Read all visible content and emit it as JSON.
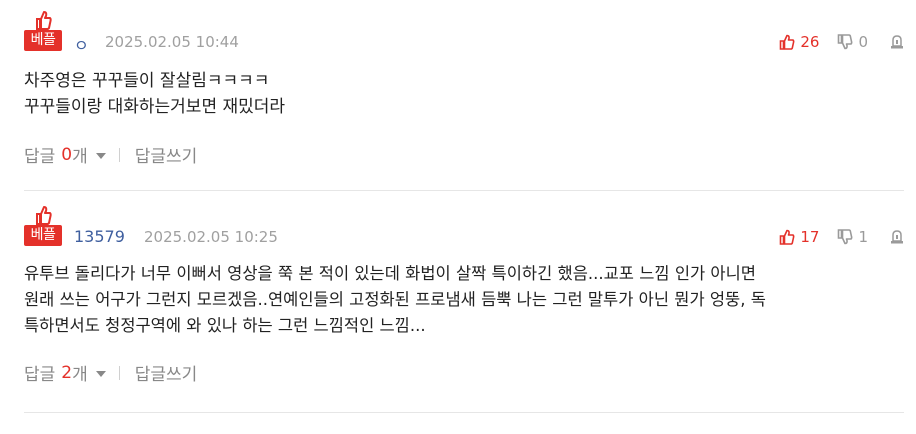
{
  "badge_label": "베플",
  "colors": {
    "accent": "#e4312a",
    "nick": "#3f5f9f",
    "muted": "#a0a0a0"
  },
  "comments": [
    {
      "nickname": "ㅇ",
      "date": "2025.02.05 10:44",
      "likes": "26",
      "dislikes": "0",
      "lines": [
        "차주영은 꾸꾸들이 잘살림ㅋㅋㅋㅋ",
        "꾸꾸들이랑 대화하는거보면 재밌더라"
      ],
      "reply_label": "답글",
      "reply_count": "0",
      "reply_unit": "개",
      "write_reply": "답글쓰기"
    },
    {
      "nickname": "13579",
      "date": "2025.02.05 10:25",
      "likes": "17",
      "dislikes": "1",
      "lines": [
        "유투브 돌리다가 너무 이뻐서 영상을 쭉 본 적이 있는데 화법이 살짝 특이하긴 했음...교포 느낌 인가 아니면",
        "원래 쓰는 어구가 그런지 모르겠음..연예인들의 고정화된 프로냄새 듬뿍 나는 그런 말투가 아닌 뭔가 엉뚱, 독",
        "특하면서도 청정구역에 와 있나 하는 그런 느낌적인 느낌..."
      ],
      "reply_label": "답글",
      "reply_count": "2",
      "reply_unit": "개",
      "write_reply": "답글쓰기"
    }
  ],
  "icons": {
    "best_thumb": "thumbs-up-icon",
    "like": "thumbs-up-icon",
    "dislike": "thumbs-down-icon",
    "report": "report-icon"
  }
}
